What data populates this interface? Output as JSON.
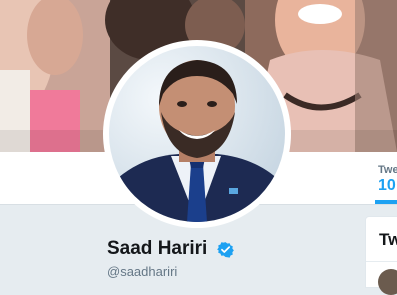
{
  "profile": {
    "name": "Saad Hariri",
    "screen_name": "@saadhariri",
    "verified": true,
    "verified_icon": "verified-badge-icon"
  },
  "nav": {
    "tab_label": "Twe",
    "tab_count": "10"
  },
  "side_card": {
    "title": "Tw"
  },
  "colors": {
    "accent": "#1da1f2",
    "page_background": "#e6ecf0",
    "name_text": "#14171a",
    "secondary_text": "#657786"
  }
}
